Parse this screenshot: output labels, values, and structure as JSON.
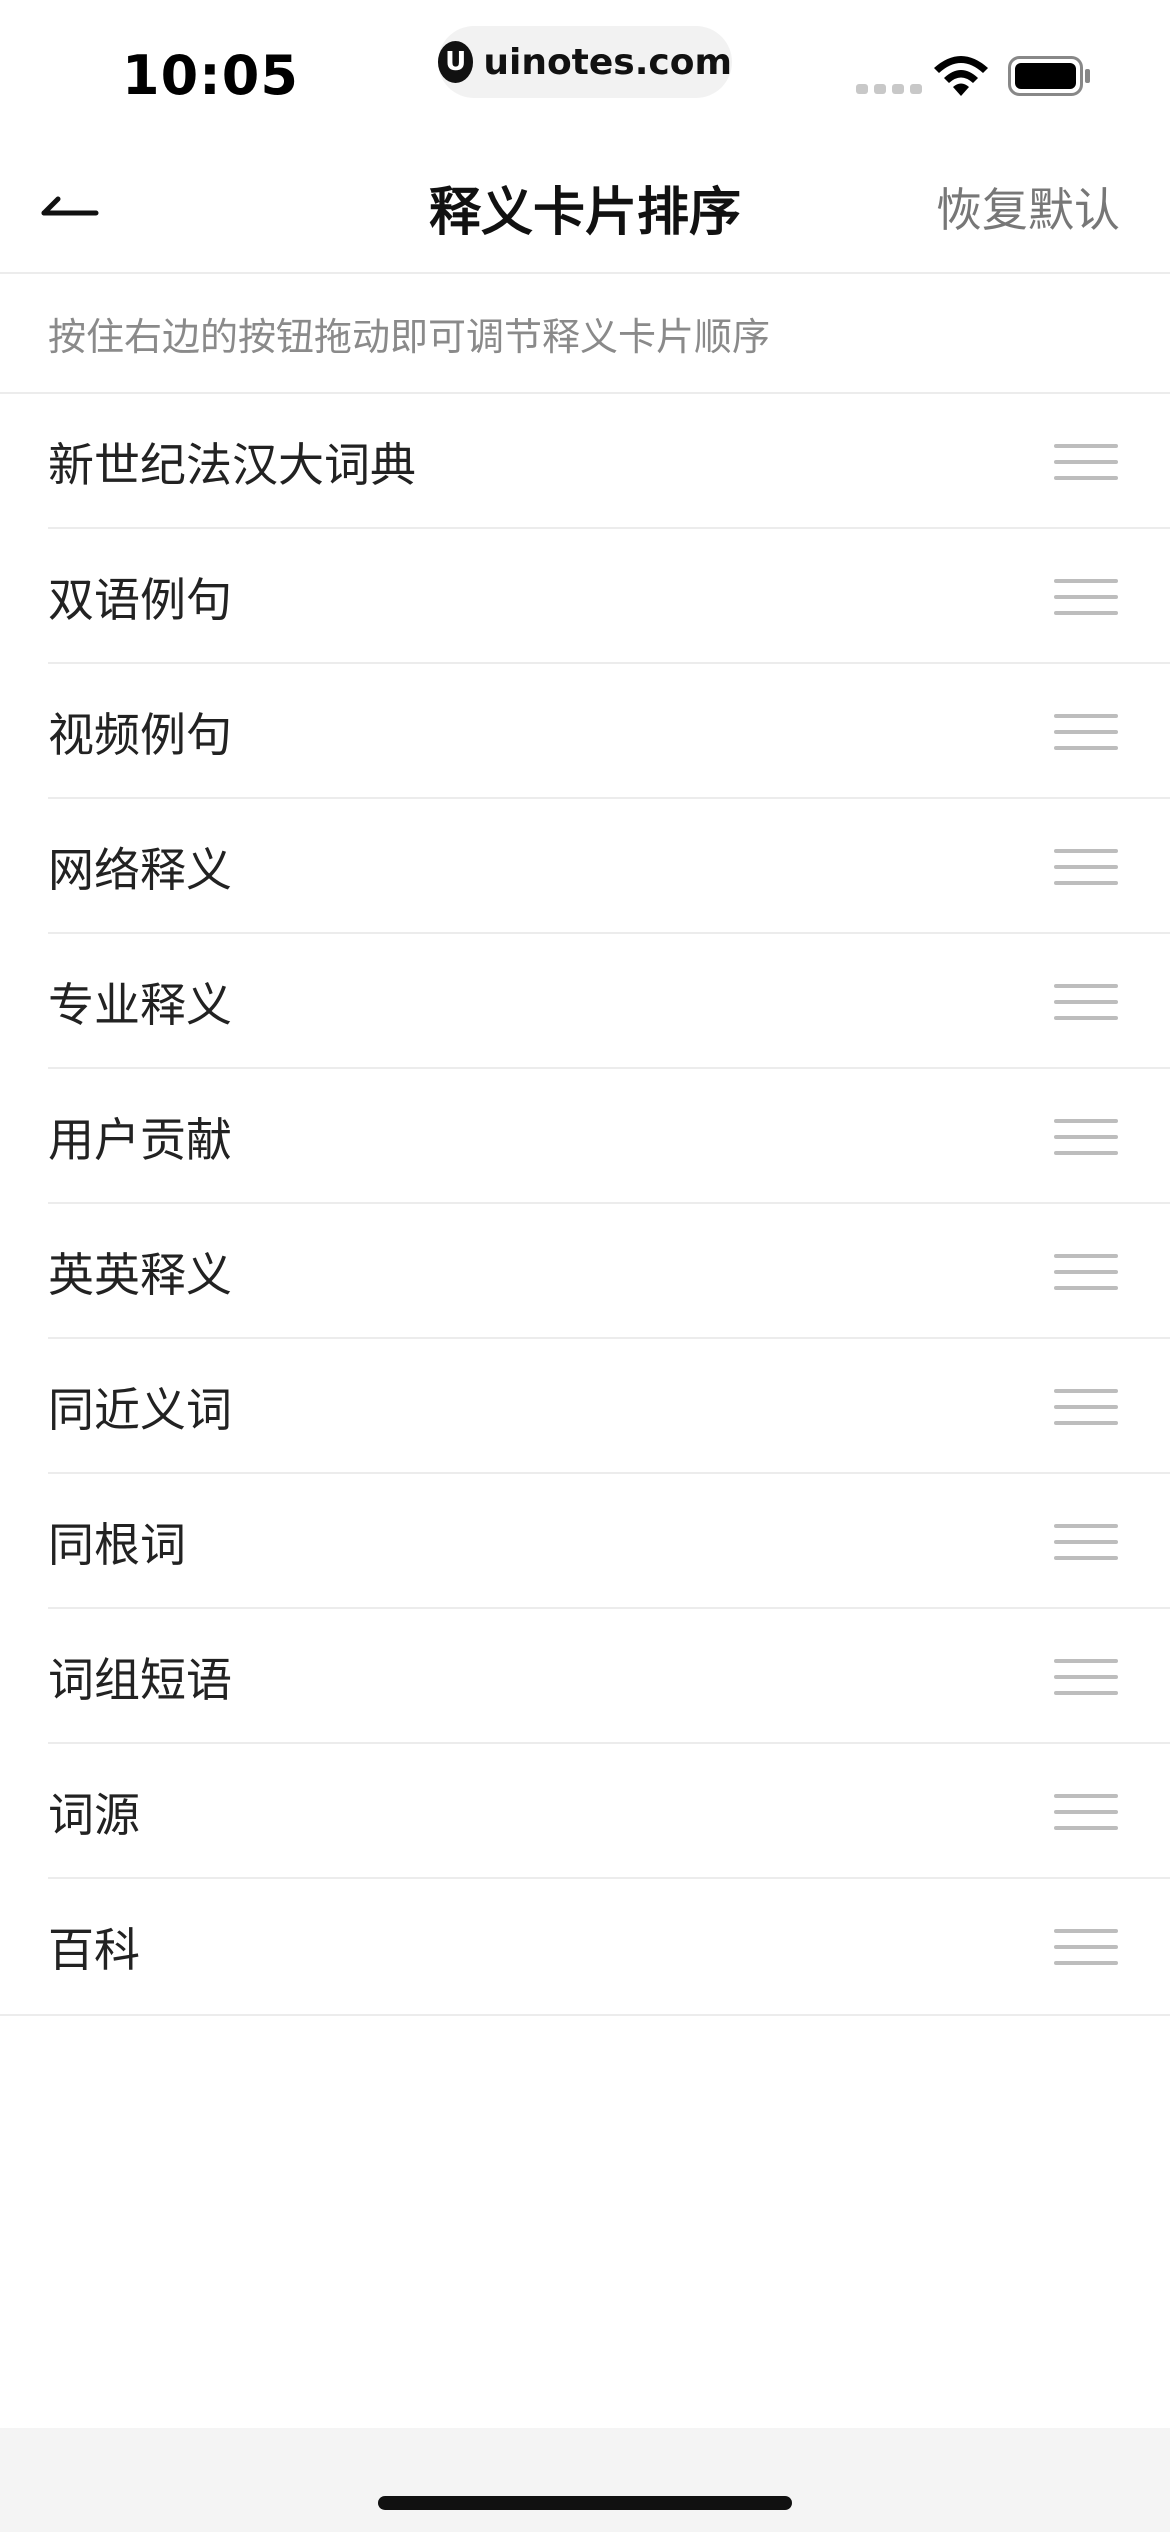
{
  "status_bar": {
    "time": "10:05",
    "watermark_logo": "U",
    "watermark_text": "uinotes.com",
    "icons": [
      "signal-icon",
      "wifi-icon",
      "battery-icon"
    ]
  },
  "nav": {
    "back_icon": "back-arrow-icon",
    "title": "释义卡片排序",
    "reset_label": "恢复默认"
  },
  "hint": "按住右边的按钮拖动即可调节释义卡片顺序",
  "cards": [
    {
      "label": "新世纪法汉大词典"
    },
    {
      "label": "双语例句"
    },
    {
      "label": "视频例句"
    },
    {
      "label": "网络释义"
    },
    {
      "label": "专业释义"
    },
    {
      "label": "用户贡献"
    },
    {
      "label": "英英释义"
    },
    {
      "label": "同近义词"
    },
    {
      "label": "同根词"
    },
    {
      "label": "词组短语"
    },
    {
      "label": "词源"
    },
    {
      "label": "百科"
    }
  ],
  "colors": {
    "background": "#ffffff",
    "text": "#222222",
    "muted": "#8a8a8a",
    "divider": "#ececec",
    "handle": "#bdbdbd",
    "bottom": "#f4f4f4"
  }
}
